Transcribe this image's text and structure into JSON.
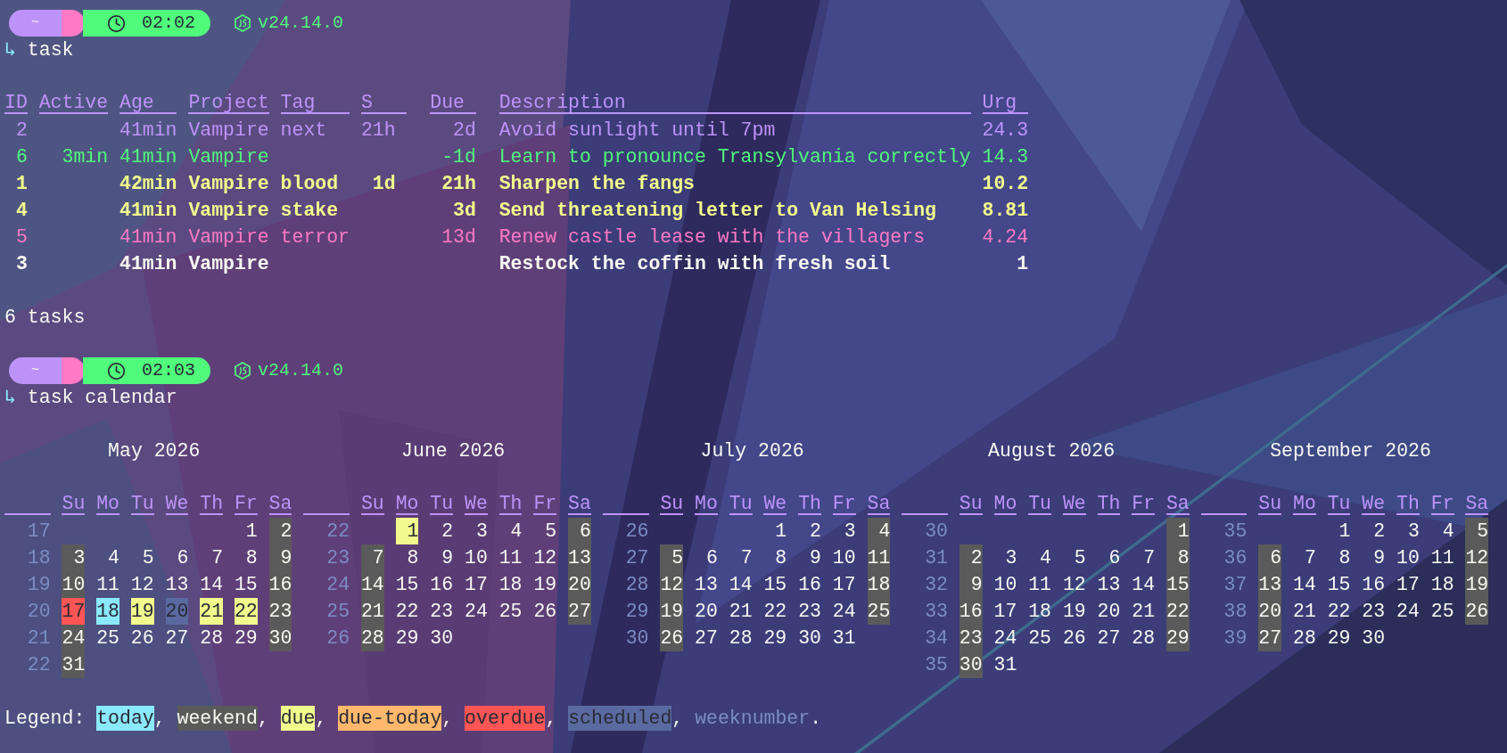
{
  "session": [
    {
      "kind": "prompt",
      "directory": "~",
      "time": "02:02",
      "node_version": "v24.14.0",
      "arrow": "↳",
      "command": "task"
    },
    {
      "kind": "task_table",
      "columns": [
        "ID",
        "Active",
        "Age",
        "Project",
        "Tag",
        "S",
        "Due",
        "Description",
        "Urg"
      ],
      "rows": [
        {
          "id": "2",
          "age": "41min",
          "project": "Vampire",
          "tag": "next",
          "s": "21h",
          "due": "2d",
          "description": "Avoid sunlight until 7pm",
          "urg": "24.3",
          "color": "#bd93f9",
          "bold": false
        },
        {
          "id": "6",
          "active": "3min",
          "age": "41min",
          "project": "Vampire",
          "due": "-1d",
          "description": "Learn to pronounce Transylvania correctly",
          "urg": "14.3",
          "color": "#50fa7b",
          "bold": false
        },
        {
          "id": "1",
          "age": "42min",
          "project": "Vampire",
          "tag": "blood",
          "s": "1d",
          "due": "21h",
          "description": "Sharpen the fangs",
          "urg": "10.2",
          "color": "#f1fa8c",
          "bold": true
        },
        {
          "id": "4",
          "age": "41min",
          "project": "Vampire",
          "tag": "stake",
          "due": "3d",
          "description": "Send threatening letter to Van Helsing",
          "urg": "8.81",
          "color": "#f1fa8c",
          "bold": true
        },
        {
          "id": "5",
          "age": "41min",
          "project": "Vampire",
          "tag": "terror",
          "due": "13d",
          "description": "Renew castle lease with the villagers",
          "urg": "4.24",
          "color": "#ff79c6",
          "bold": false
        },
        {
          "id": "3",
          "age": "41min",
          "project": "Vampire",
          "description": "Restock the coffin with fresh soil",
          "urg": "1",
          "color": "#f8f8f2",
          "bold": true
        }
      ],
      "summary": "6 tasks"
    },
    {
      "kind": "prompt",
      "directory": "~",
      "time": "02:03",
      "node_version": "v24.14.0",
      "arrow": "↳",
      "command": "task calendar"
    },
    {
      "kind": "calendar",
      "months": [
        {
          "title": "May 2026",
          "weekdays": [
            "Su",
            "Mo",
            "Tu",
            "We",
            "Th",
            "Fr",
            "Sa"
          ],
          "weeks": [
            {
              "number": "17",
              "days": [
                {
                  "day": "1",
                  "kind": "plain"
                },
                {
                  "day": "2",
                  "kind": "weekend"
                }
              ]
            },
            {
              "number": "18",
              "days": [
                {
                  "day": "3",
                  "kind": "weekend"
                },
                {
                  "day": "4",
                  "kind": "plain"
                },
                {
                  "day": "5",
                  "kind": "plain"
                },
                {
                  "day": "6",
                  "kind": "plain"
                },
                {
                  "day": "7",
                  "kind": "plain"
                },
                {
                  "day": "8",
                  "kind": "plain"
                },
                {
                  "day": "9",
                  "kind": "weekend"
                }
              ]
            },
            {
              "number": "19",
              "days": [
                {
                  "day": "10",
                  "kind": "weekend"
                },
                {
                  "day": "11",
                  "kind": "plain"
                },
                {
                  "day": "12",
                  "kind": "plain"
                },
                {
                  "day": "13",
                  "kind": "plain"
                },
                {
                  "day": "14",
                  "kind": "plain"
                },
                {
                  "day": "15",
                  "kind": "plain"
                },
                {
                  "day": "16",
                  "kind": "weekend"
                }
              ]
            },
            {
              "number": "20",
              "days": [
                {
                  "day": "17",
                  "kind": "overdue"
                },
                {
                  "day": "18",
                  "kind": "today"
                },
                {
                  "day": "19",
                  "kind": "due"
                },
                {
                  "day": "20",
                  "kind": "scheduled"
                },
                {
                  "day": "21",
                  "kind": "due"
                },
                {
                  "day": "22",
                  "kind": "due"
                },
                {
                  "day": "23",
                  "kind": "weekend"
                }
              ]
            },
            {
              "number": "21",
              "days": [
                {
                  "day": "24",
                  "kind": "weekend"
                },
                {
                  "day": "25",
                  "kind": "plain"
                },
                {
                  "day": "26",
                  "kind": "plain"
                },
                {
                  "day": "27",
                  "kind": "plain"
                },
                {
                  "day": "28",
                  "kind": "plain"
                },
                {
                  "day": "29",
                  "kind": "plain"
                },
                {
                  "day": "30",
                  "kind": "weekend"
                }
              ]
            },
            {
              "number": "22",
              "days": [
                {
                  "day": "31",
                  "kind": "weekend"
                }
              ]
            }
          ]
        },
        {
          "title": "June 2026",
          "weekdays": [
            "Su",
            "Mo",
            "Tu",
            "We",
            "Th",
            "Fr",
            "Sa"
          ],
          "weeks": [
            {
              "number": "22",
              "days": [
                {
                  "day": "1",
                  "kind": "due"
                },
                {
                  "day": "2",
                  "kind": "plain"
                },
                {
                  "day": "3",
                  "kind": "plain"
                },
                {
                  "day": "4",
                  "kind": "plain"
                },
                {
                  "day": "5",
                  "kind": "plain"
                },
                {
                  "day": "6",
                  "kind": "weekend"
                }
              ]
            },
            {
              "number": "23",
              "days": [
                {
                  "day": "7",
                  "kind": "weekend"
                },
                {
                  "day": "8",
                  "kind": "plain"
                },
                {
                  "day": "9",
                  "kind": "plain"
                },
                {
                  "day": "10",
                  "kind": "plain"
                },
                {
                  "day": "11",
                  "kind": "plain"
                },
                {
                  "day": "12",
                  "kind": "plain"
                },
                {
                  "day": "13",
                  "kind": "weekend"
                }
              ]
            },
            {
              "number": "24",
              "days": [
                {
                  "day": "14",
                  "kind": "weekend"
                },
                {
                  "day": "15",
                  "kind": "plain"
                },
                {
                  "day": "16",
                  "kind": "plain"
                },
                {
                  "day": "17",
                  "kind": "plain"
                },
                {
                  "day": "18",
                  "kind": "plain"
                },
                {
                  "day": "19",
                  "kind": "plain"
                },
                {
                  "day": "20",
                  "kind": "weekend"
                }
              ]
            },
            {
              "number": "25",
              "days": [
                {
                  "day": "21",
                  "kind": "weekend"
                },
                {
                  "day": "22",
                  "kind": "plain"
                },
                {
                  "day": "23",
                  "kind": "plain"
                },
                {
                  "day": "24",
                  "kind": "plain"
                },
                {
                  "day": "25",
                  "kind": "plain"
                },
                {
                  "day": "26",
                  "kind": "plain"
                },
                {
                  "day": "27",
                  "kind": "weekend"
                }
              ]
            },
            {
              "number": "26",
              "days": [
                {
                  "day": "28",
                  "kind": "weekend"
                },
                {
                  "day": "29",
                  "kind": "plain"
                },
                {
                  "day": "30",
                  "kind": "plain"
                }
              ]
            }
          ]
        },
        {
          "title": "July 2026",
          "weekdays": [
            "Su",
            "Mo",
            "Tu",
            "We",
            "Th",
            "Fr",
            "Sa"
          ],
          "weeks": [
            {
              "number": "26",
              "days": [
                {
                  "day": "1",
                  "kind": "plain"
                },
                {
                  "day": "2",
                  "kind": "plain"
                },
                {
                  "day": "3",
                  "kind": "plain"
                },
                {
                  "day": "4",
                  "kind": "weekend"
                }
              ]
            },
            {
              "number": "27",
              "days": [
                {
                  "day": "5",
                  "kind": "weekend"
                },
                {
                  "day": "6",
                  "kind": "plain"
                },
                {
                  "day": "7",
                  "kind": "plain"
                },
                {
                  "day": "8",
                  "kind": "plain"
                },
                {
                  "day": "9",
                  "kind": "plain"
                },
                {
                  "day": "10",
                  "kind": "plain"
                },
                {
                  "day": "11",
                  "kind": "weekend"
                }
              ]
            },
            {
              "number": "28",
              "days": [
                {
                  "day": "12",
                  "kind": "weekend"
                },
                {
                  "day": "13",
                  "kind": "plain"
                },
                {
                  "day": "14",
                  "kind": "plain"
                },
                {
                  "day": "15",
                  "kind": "plain"
                },
                {
                  "day": "16",
                  "kind": "plain"
                },
                {
                  "day": "17",
                  "kind": "plain"
                },
                {
                  "day": "18",
                  "kind": "weekend"
                }
              ]
            },
            {
              "number": "29",
              "days": [
                {
                  "day": "19",
                  "kind": "weekend"
                },
                {
                  "day": "20",
                  "kind": "plain"
                },
                {
                  "day": "21",
                  "kind": "plain"
                },
                {
                  "day": "22",
                  "kind": "plain"
                },
                {
                  "day": "23",
                  "kind": "plain"
                },
                {
                  "day": "24",
                  "kind": "plain"
                },
                {
                  "day": "25",
                  "kind": "weekend"
                }
              ]
            },
            {
              "number": "30",
              "days": [
                {
                  "day": "26",
                  "kind": "weekend"
                },
                {
                  "day": "27",
                  "kind": "plain"
                },
                {
                  "day": "28",
                  "kind": "plain"
                },
                {
                  "day": "29",
                  "kind": "plain"
                },
                {
                  "day": "30",
                  "kind": "plain"
                },
                {
                  "day": "31",
                  "kind": "plain"
                }
              ]
            }
          ]
        },
        {
          "title": "August 2026",
          "weekdays": [
            "Su",
            "Mo",
            "Tu",
            "We",
            "Th",
            "Fr",
            "Sa"
          ],
          "weeks": [
            {
              "number": "30",
              "days": [
                {
                  "day": "1",
                  "kind": "weekend"
                }
              ]
            },
            {
              "number": "31",
              "days": [
                {
                  "day": "2",
                  "kind": "weekend"
                },
                {
                  "day": "3",
                  "kind": "plain"
                },
                {
                  "day": "4",
                  "kind": "plain"
                },
                {
                  "day": "5",
                  "kind": "plain"
                },
                {
                  "day": "6",
                  "kind": "plain"
                },
                {
                  "day": "7",
                  "kind": "plain"
                },
                {
                  "day": "8",
                  "kind": "weekend"
                }
              ]
            },
            {
              "number": "32",
              "days": [
                {
                  "day": "9",
                  "kind": "weekend"
                },
                {
                  "day": "10",
                  "kind": "plain"
                },
                {
                  "day": "11",
                  "kind": "plain"
                },
                {
                  "day": "12",
                  "kind": "plain"
                },
                {
                  "day": "13",
                  "kind": "plain"
                },
                {
                  "day": "14",
                  "kind": "plain"
                },
                {
                  "day": "15",
                  "kind": "weekend"
                }
              ]
            },
            {
              "number": "33",
              "days": [
                {
                  "day": "16",
                  "kind": "weekend"
                },
                {
                  "day": "17",
                  "kind": "plain"
                },
                {
                  "day": "18",
                  "kind": "plain"
                },
                {
                  "day": "19",
                  "kind": "plain"
                },
                {
                  "day": "20",
                  "kind": "plain"
                },
                {
                  "day": "21",
                  "kind": "plain"
                },
                {
                  "day": "22",
                  "kind": "weekend"
                }
              ]
            },
            {
              "number": "34",
              "days": [
                {
                  "day": "23",
                  "kind": "weekend"
                },
                {
                  "day": "24",
                  "kind": "plain"
                },
                {
                  "day": "25",
                  "kind": "plain"
                },
                {
                  "day": "26",
                  "kind": "plain"
                },
                {
                  "day": "27",
                  "kind": "plain"
                },
                {
                  "day": "28",
                  "kind": "plain"
                },
                {
                  "day": "29",
                  "kind": "weekend"
                }
              ]
            },
            {
              "number": "35",
              "days": [
                {
                  "day": "30",
                  "kind": "weekend"
                },
                {
                  "day": "31",
                  "kind": "plain"
                }
              ]
            }
          ]
        },
        {
          "title": "September 2026",
          "weekdays": [
            "Su",
            "Mo",
            "Tu",
            "We",
            "Th",
            "Fr",
            "Sa"
          ],
          "weeks": [
            {
              "number": "35",
              "days": [
                {
                  "day": "1",
                  "kind": "plain"
                },
                {
                  "day": "2",
                  "kind": "plain"
                },
                {
                  "day": "3",
                  "kind": "plain"
                },
                {
                  "day": "4",
                  "kind": "plain"
                },
                {
                  "day": "5",
                  "kind": "weekend"
                }
              ]
            },
            {
              "number": "36",
              "days": [
                {
                  "day": "6",
                  "kind": "weekend"
                },
                {
                  "day": "7",
                  "kind": "plain"
                },
                {
                  "day": "8",
                  "kind": "plain"
                },
                {
                  "day": "9",
                  "kind": "plain"
                },
                {
                  "day": "10",
                  "kind": "plain"
                },
                {
                  "day": "11",
                  "kind": "plain"
                },
                {
                  "day": "12",
                  "kind": "weekend"
                }
              ]
            },
            {
              "number": "37",
              "days": [
                {
                  "day": "13",
                  "kind": "weekend"
                },
                {
                  "day": "14",
                  "kind": "plain"
                },
                {
                  "day": "15",
                  "kind": "plain"
                },
                {
                  "day": "16",
                  "kind": "plain"
                },
                {
                  "day": "17",
                  "kind": "plain"
                },
                {
                  "day": "18",
                  "kind": "plain"
                },
                {
                  "day": "19",
                  "kind": "weekend"
                }
              ]
            },
            {
              "number": "38",
              "days": [
                {
                  "day": "20",
                  "kind": "weekend"
                },
                {
                  "day": "21",
                  "kind": "plain"
                },
                {
                  "day": "22",
                  "kind": "plain"
                },
                {
                  "day": "23",
                  "kind": "plain"
                },
                {
                  "day": "24",
                  "kind": "plain"
                },
                {
                  "day": "25",
                  "kind": "plain"
                },
                {
                  "day": "26",
                  "kind": "weekend"
                }
              ]
            },
            {
              "number": "39",
              "days": [
                {
                  "day": "27",
                  "kind": "weekend"
                },
                {
                  "day": "28",
                  "kind": "plain"
                },
                {
                  "day": "29",
                  "kind": "plain"
                },
                {
                  "day": "30",
                  "kind": "plain"
                }
              ]
            }
          ]
        }
      ],
      "legend": {
        "label": "Legend:",
        "items": [
          {
            "label": "today",
            "kind": "today",
            "after": ","
          },
          {
            "label": "weekend",
            "kind": "weekend",
            "after": ","
          },
          {
            "label": "due",
            "kind": "due",
            "after": ","
          },
          {
            "label": "due-today",
            "kind": "due-today",
            "after": ","
          },
          {
            "label": "overdue",
            "kind": "overdue",
            "after": ","
          },
          {
            "label": "scheduled",
            "kind": "scheduled",
            "after": ","
          },
          {
            "label": "weeknumber",
            "kind": "weeknumber",
            "after": "."
          }
        ]
      }
    }
  ]
}
